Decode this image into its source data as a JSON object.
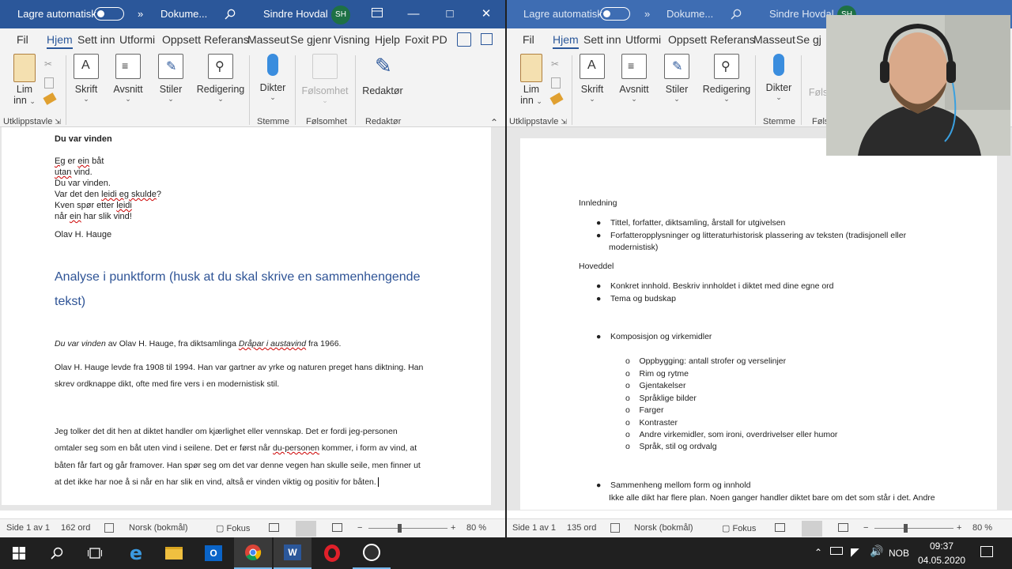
{
  "left": {
    "titlebar": {
      "autosave": "Lagre automatisk",
      "more": "»",
      "doc": "Dokume...",
      "user": "Sindre Hovdal",
      "initials": "SH"
    },
    "tabs": [
      "Fil",
      "Hjem",
      "Sett inn",
      "Utformi",
      "Oppsett",
      "Referans",
      "Masseut",
      "Se gjenr",
      "Visning",
      "Hjelp",
      "Foxit PD"
    ],
    "ribbon": {
      "lim": "Lim",
      "inn": "inn",
      "skrift": "Skrift",
      "avsnitt": "Avsnitt",
      "stiler": "Stiler",
      "redigering": "Redigering",
      "dikter": "Dikter",
      "folsomhet": "Følsomhet",
      "redaktor": "Redaktør",
      "grp_utklipp": "Utklippstavle",
      "grp_stemme": "Stemme",
      "grp_folsomhet": "Følsomhet",
      "grp_redaktor": "Redaktør"
    },
    "doc": {
      "poem_title": "Du var vinden",
      "poem_lines": [
        "Eg er ein båt",
        "utan vind.",
        "Du var vinden.",
        "Var det den leidi eg skulde?",
        "Kven spør etter leidi",
        "når ein har slik vind!"
      ],
      "author": "Olav H. Hauge",
      "heading1": "Analyse i punktform (husk at du skal skrive en sammenhengende",
      "heading2": "tekst)",
      "p1_title": "Du var vinden",
      "p1_mid": " av Olav H. Hauge, fra diktsamlinga ",
      "p1_book": "Dråpar i austavind",
      "p1_end": " fra 1966.",
      "p2": [
        "Olav H. Hauge levde fra 1908 til 1994. Han var gartner av yrke og naturen preget hans diktning. Han",
        "skrev ordknappe dikt, ofte med fire vers i en modernistisk stil."
      ],
      "p3": [
        "Jeg tolker det dit hen at diktet handler om kjærlighet eller vennskap. Det er fordi jeg-personen",
        "omtaler seg som en båt uten vind i seilene. Det er først når du-personen kommer, i form av vind, at",
        "båten får fart og går framover. Han spør seg om det var denne vegen han skulle seile, men finner ut",
        "at det ikke har noe å si når en har slik en vind, altså er vinden viktig og positiv for båten."
      ]
    },
    "status": {
      "page": "Side 1 av 1",
      "words": "162 ord",
      "lang": "Norsk (bokmål)",
      "focus": "Fokus",
      "zoom": "80 %"
    }
  },
  "right": {
    "titlebar": {
      "autosave": "Lagre automatisk",
      "more": "»",
      "doc": "Dokume...",
      "user": "Sindre Hovdal",
      "initials": "SH"
    },
    "tabs": [
      "Fil",
      "Hjem",
      "Sett inn",
      "Utformi",
      "Oppsett",
      "Referans",
      "Masseut",
      "Se gj"
    ],
    "ribbon": {
      "lim": "Lim",
      "inn": "inn",
      "skrift": "Skrift",
      "avsnitt": "Avsnitt",
      "stiler": "Stiler",
      "redigering": "Redigering",
      "dikter": "Dikter",
      "folsomhet": "Føls",
      "grp_utklipp": "Utklippstavle",
      "grp_stemme": "Stemme",
      "grp_folsomhet": "Føls"
    },
    "doc": {
      "innledning": "Innledning",
      "innledning_items": [
        "Tittel, forfatter, diktsamling, årstall for utgivelsen",
        "Forfatteropplysninger og litteraturhistorisk plassering av teksten (tradisjonell eller",
        "modernistisk)"
      ],
      "hoveddel": "Hoveddel",
      "hoveddel_items": [
        "Konkret innhold. Beskriv innholdet i diktet med dine egne ord",
        "Tema og budskap"
      ],
      "komposisjon": "Komposisjon og virkemidler",
      "sub_items": [
        "Oppbygging: antall strofer og verselinjer",
        "Rim og rytme",
        "Gjentakelser",
        "Språklige bilder",
        "Farger",
        "Kontraster",
        "Andre virkemidler, som ironi, overdrivelser eller humor",
        "Språk, stil og ordvalg"
      ],
      "sammenheng": "Sammenheng mellom form og innhold",
      "sammenheng_text": "Ikke alle dikt har flere plan. Noen ganger handler diktet bare om det som står i det. Andre"
    },
    "status": {
      "page": "Side 1 av 1",
      "words": "135 ord",
      "lang": "Norsk (bokmål)",
      "focus": "Fokus",
      "zoom": "80 %"
    }
  },
  "taskbar": {
    "lang": "NOB",
    "time": "09:37",
    "date": "04.05.2020"
  },
  "colors": {
    "word_blue": "#2b579a",
    "heading_blue": "#2f5496",
    "taskbar": "#202020"
  }
}
